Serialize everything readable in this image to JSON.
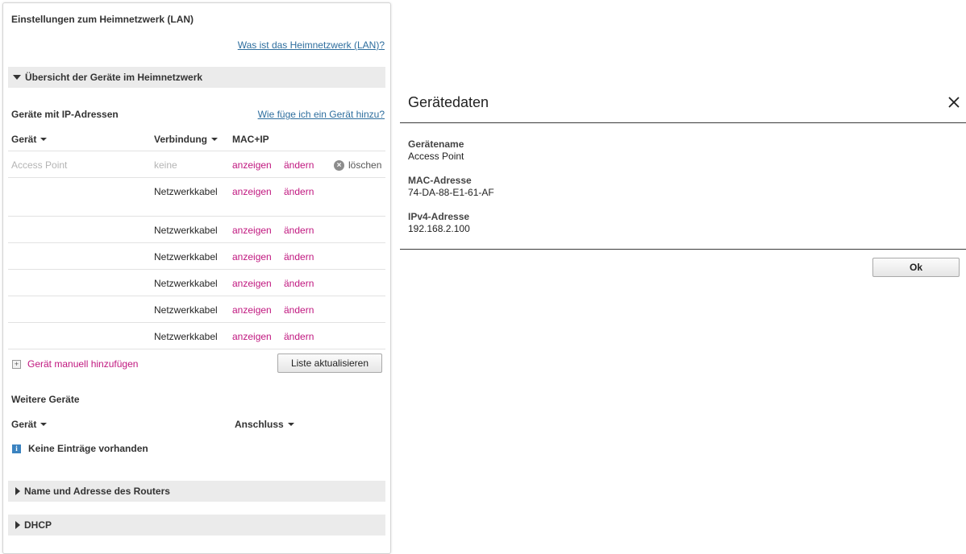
{
  "panel": {
    "title": "Einstellungen zum Heimnetzwerk (LAN)",
    "help_lan": "Was ist das Heimnetzwerk (LAN)?",
    "section_overview": "Übersicht der Geräte im Heimnetzwerk",
    "ip_devices_heading": "Geräte mit IP-Adressen",
    "help_add": "Wie füge ich ein Gerät hinzu?",
    "columns": {
      "device": "Gerät",
      "connection": "Verbindung",
      "macip": "MAC+IP"
    },
    "rows": [
      {
        "name": "Access Point",
        "connection": "keine",
        "show": "anzeigen",
        "edit": "ändern",
        "delete": "löschen"
      },
      {
        "name": "",
        "connection": "Netzwerkkabel",
        "show": "anzeigen",
        "edit": "ändern"
      },
      {
        "name": "",
        "connection": "Netzwerkkabel",
        "show": "anzeigen",
        "edit": "ändern"
      },
      {
        "name": "",
        "connection": "Netzwerkkabel",
        "show": "anzeigen",
        "edit": "ändern"
      },
      {
        "name": "",
        "connection": "Netzwerkkabel",
        "show": "anzeigen",
        "edit": "ändern"
      },
      {
        "name": "",
        "connection": "Netzwerkkabel",
        "show": "anzeigen",
        "edit": "ändern"
      },
      {
        "name": "",
        "connection": "Netzwerkkabel",
        "show": "anzeigen",
        "edit": "ändern"
      }
    ],
    "add_manual": "Gerät manuell hinzufügen",
    "refresh_button": "Liste aktualisieren",
    "more_devices_heading": "Weitere Geräte",
    "columns2": {
      "device": "Gerät",
      "port": "Anschluss"
    },
    "no_entries": "Keine Einträge vorhanden",
    "section_router": "Name und Adresse des Routers",
    "section_dhcp": "DHCP"
  },
  "dialog": {
    "title": "Gerätedaten",
    "device_name_label": "Gerätename",
    "device_name_value": "Access Point",
    "mac_label": "MAC-Adresse",
    "mac_value": "74-DA-88-E1-61-AF",
    "ipv4_label": "IPv4-Adresse",
    "ipv4_value": "192.168.2.100",
    "ok_button": "Ok"
  }
}
